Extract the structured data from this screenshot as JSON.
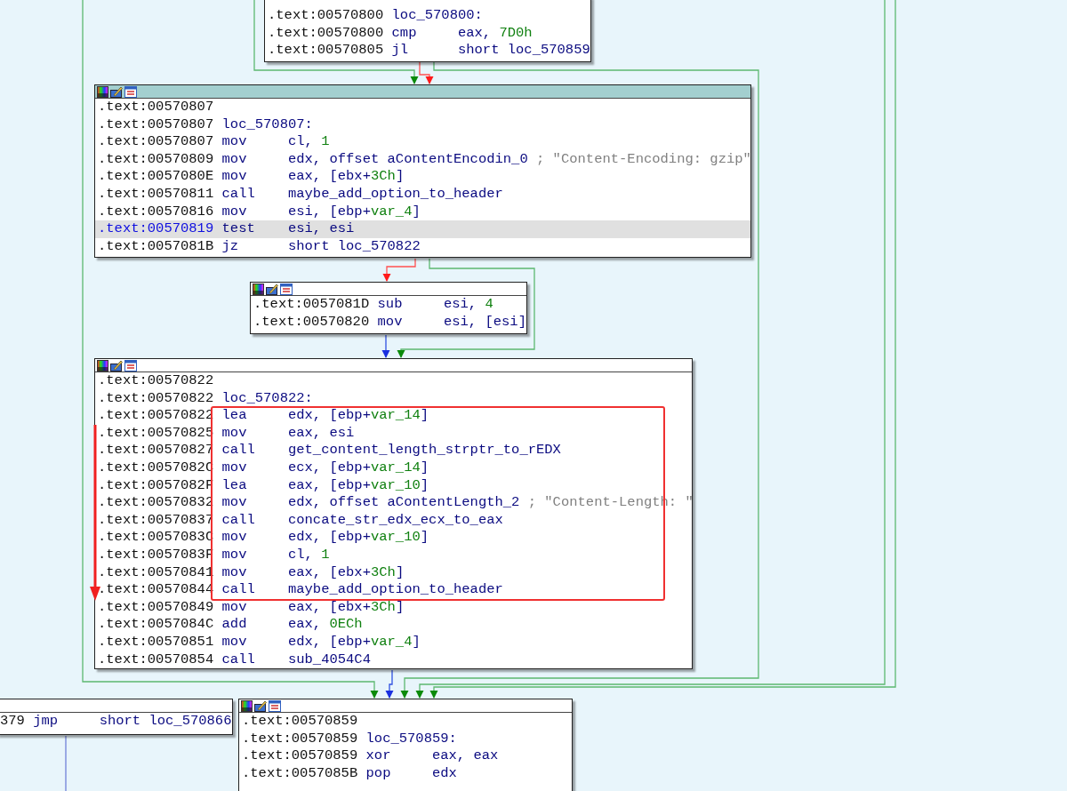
{
  "blocks": [
    {
      "lines": [
        {
          "address": ".text:00570800",
          "label": "loc_570800:",
          "selected": false
        },
        {
          "address": ".text:00570800",
          "mnemonic": "cmp",
          "operands": [
            {
              "text": "eax, ",
              "kind": "text"
            },
            {
              "text": "7D0h",
              "kind": "num"
            }
          ],
          "selected": false
        },
        {
          "address": ".text:00570805",
          "mnemonic": "jl",
          "operands": [
            {
              "text": "short loc_570859",
              "kind": "text"
            }
          ],
          "selected": false
        }
      ]
    },
    {
      "selected": true,
      "header_icons": true,
      "lines": [
        {
          "address": ".text:00570807",
          "selected": false
        },
        {
          "address": ".text:00570807",
          "label": "loc_570807:",
          "selected": false
        },
        {
          "address": ".text:00570807",
          "mnemonic": "mov",
          "operands": [
            {
              "text": "cl, ",
              "kind": "text"
            },
            {
              "text": "1",
              "kind": "num"
            }
          ],
          "selected": false
        },
        {
          "address": ".text:00570809",
          "mnemonic": "mov",
          "operands": [
            {
              "text": "edx, offset aContentEncodin_0",
              "kind": "text"
            }
          ],
          "comment": "; \"Content-Encoding: gzip\"",
          "selected": false
        },
        {
          "address": ".text:0057080E",
          "mnemonic": "mov",
          "operands": [
            {
              "text": "eax, [ebx+",
              "kind": "text"
            },
            {
              "text": "3Ch",
              "kind": "num"
            },
            {
              "text": "]",
              "kind": "text"
            }
          ],
          "selected": false
        },
        {
          "address": ".text:00570811",
          "mnemonic": "call",
          "operands": [
            {
              "text": "maybe_add_option_to_header",
              "kind": "text"
            }
          ],
          "selected": false
        },
        {
          "address": ".text:00570816",
          "mnemonic": "mov",
          "operands": [
            {
              "text": "esi, [ebp+",
              "kind": "text"
            },
            {
              "text": "var_4",
              "kind": "num"
            },
            {
              "text": "]",
              "kind": "text"
            }
          ],
          "selected": false
        },
        {
          "address": ".text:00570819",
          "mnemonic": "test",
          "operands": [
            {
              "text": "esi, esi",
              "kind": "text"
            }
          ],
          "selected": true
        },
        {
          "address": ".text:0057081B",
          "mnemonic": "jz",
          "operands": [
            {
              "text": "short loc_570822",
              "kind": "text"
            }
          ],
          "selected": false
        }
      ]
    },
    {
      "selected": false,
      "header_icons": true,
      "lines": [
        {
          "address": ".text:0057081D",
          "mnemonic": "sub",
          "operands": [
            {
              "text": "esi, ",
              "kind": "text"
            },
            {
              "text": "4",
              "kind": "num"
            }
          ],
          "selected": false
        },
        {
          "address": ".text:00570820",
          "mnemonic": "mov",
          "operands": [
            {
              "text": "esi, [esi]",
              "kind": "text"
            }
          ],
          "selected": false
        }
      ]
    },
    {
      "selected": false,
      "header_icons": true,
      "lines": [
        {
          "address": ".text:00570822",
          "selected": false
        },
        {
          "address": ".text:00570822",
          "label": "loc_570822:",
          "selected": false
        },
        {
          "address": ".text:00570822",
          "mnemonic": "lea",
          "operands": [
            {
              "text": "edx, [ebp+",
              "kind": "text"
            },
            {
              "text": "var_14",
              "kind": "num"
            },
            {
              "text": "]",
              "kind": "text"
            }
          ],
          "selected": false
        },
        {
          "address": ".text:00570825",
          "mnemonic": "mov",
          "operands": [
            {
              "text": "eax, esi",
              "kind": "text"
            }
          ],
          "selected": false
        },
        {
          "address": ".text:00570827",
          "mnemonic": "call",
          "operands": [
            {
              "text": "get_content_length_strptr_to_rEDX",
              "kind": "text"
            }
          ],
          "selected": false
        },
        {
          "address": ".text:0057082C",
          "mnemonic": "mov",
          "operands": [
            {
              "text": "ecx, [ebp+",
              "kind": "text"
            },
            {
              "text": "var_14",
              "kind": "num"
            },
            {
              "text": "]",
              "kind": "text"
            }
          ],
          "selected": false
        },
        {
          "address": ".text:0057082F",
          "mnemonic": "lea",
          "operands": [
            {
              "text": "eax, [ebp+",
              "kind": "text"
            },
            {
              "text": "var_10",
              "kind": "num"
            },
            {
              "text": "]",
              "kind": "text"
            }
          ],
          "selected": false
        },
        {
          "address": ".text:00570832",
          "mnemonic": "mov",
          "operands": [
            {
              "text": "edx, offset aContentLength_2",
              "kind": "text"
            }
          ],
          "comment": "; \"Content-Length: \"",
          "selected": false
        },
        {
          "address": ".text:00570837",
          "mnemonic": "call",
          "operands": [
            {
              "text": "concate_str_edx_ecx_to_eax",
              "kind": "text"
            }
          ],
          "selected": false
        },
        {
          "address": ".text:0057083C",
          "mnemonic": "mov",
          "operands": [
            {
              "text": "edx, [ebp+",
              "kind": "text"
            },
            {
              "text": "var_10",
              "kind": "num"
            },
            {
              "text": "]",
              "kind": "text"
            }
          ],
          "selected": false
        },
        {
          "address": ".text:0057083F",
          "mnemonic": "mov",
          "operands": [
            {
              "text": "cl, ",
              "kind": "text"
            },
            {
              "text": "1",
              "kind": "num"
            }
          ],
          "selected": false
        },
        {
          "address": ".text:00570841",
          "mnemonic": "mov",
          "operands": [
            {
              "text": "eax, [ebx+",
              "kind": "text"
            },
            {
              "text": "3Ch",
              "kind": "num"
            },
            {
              "text": "]",
              "kind": "text"
            }
          ],
          "selected": false
        },
        {
          "address": ".text:00570844",
          "mnemonic": "call",
          "operands": [
            {
              "text": "maybe_add_option_to_header",
              "kind": "text"
            }
          ],
          "selected": false
        },
        {
          "address": ".text:00570849",
          "mnemonic": "mov",
          "operands": [
            {
              "text": "eax, [ebx+",
              "kind": "text"
            },
            {
              "text": "3Ch",
              "kind": "num"
            },
            {
              "text": "]",
              "kind": "text"
            }
          ],
          "selected": false
        },
        {
          "address": ".text:0057084C",
          "mnemonic": "add",
          "operands": [
            {
              "text": "eax, ",
              "kind": "text"
            },
            {
              "text": "0ECh",
              "kind": "num"
            }
          ],
          "selected": false
        },
        {
          "address": ".text:00570851",
          "mnemonic": "mov",
          "operands": [
            {
              "text": "edx, [ebp+",
              "kind": "text"
            },
            {
              "text": "var_4",
              "kind": "num"
            },
            {
              "text": "]",
              "kind": "text"
            }
          ],
          "selected": false
        },
        {
          "address": ".text:00570854",
          "mnemonic": "call",
          "operands": [
            {
              "text": "sub_4054C4",
              "kind": "text"
            }
          ],
          "selected": false
        }
      ]
    },
    {
      "selected": false,
      "header_icons": false,
      "lines": [
        {
          "address": "379",
          "mnemonic": "jmp",
          "operands": [
            {
              "text": "short loc_570866",
              "kind": "text"
            }
          ],
          "selected": false
        }
      ]
    },
    {
      "selected": false,
      "header_icons": true,
      "lines": [
        {
          "address": ".text:00570859",
          "selected": false
        },
        {
          "address": ".text:00570859",
          "label": "loc_570859:",
          "selected": false
        },
        {
          "address": ".text:00570859",
          "mnemonic": "xor",
          "operands": [
            {
              "text": "eax, eax",
              "kind": "text"
            }
          ],
          "selected": false
        },
        {
          "address": ".text:0057085B",
          "mnemonic": "pop",
          "operands": [
            {
              "text": "edx",
              "kind": "text"
            }
          ],
          "selected": false
        }
      ]
    }
  ]
}
